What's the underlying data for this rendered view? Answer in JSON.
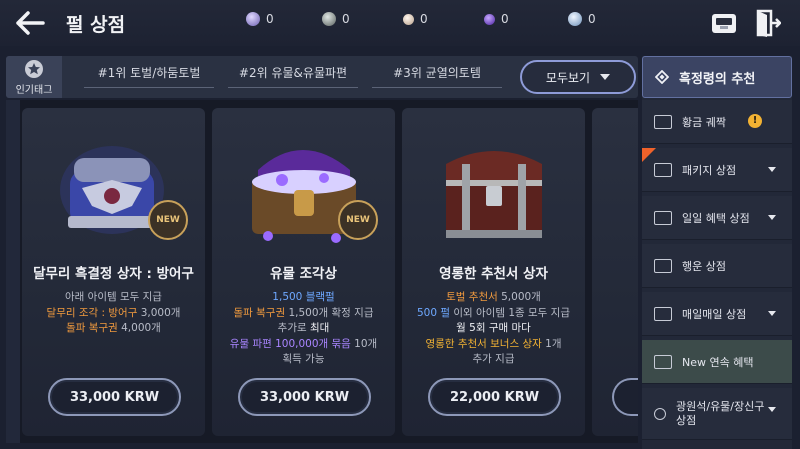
{
  "header": {
    "title": "펄 상점",
    "currencies": [
      {
        "icon": "moonstone-icon",
        "value": "0",
        "color": "#b7a9ff"
      },
      {
        "icon": "silver-coin-icon",
        "value": "0",
        "color": "#9aa3a0"
      },
      {
        "icon": "pearl-icon",
        "value": "0",
        "color": "#e8d8c8"
      },
      {
        "icon": "purple-pearl-icon",
        "value": "0",
        "color": "#7a4fd6"
      },
      {
        "icon": "blue-crystal-icon",
        "value": "0",
        "color": "#a8c8f0"
      }
    ]
  },
  "tagbar": {
    "popular_label": "인기태그",
    "tags": [
      "#1위 토벌/하둠토벌",
      "#2위 유물&유물파편",
      "#3위 균열의토템"
    ],
    "view_all": "모두보기"
  },
  "products": [
    {
      "name": "달무리 흑결정 상자 : 방어구",
      "badge": "NEW",
      "desc": [
        [
          {
            "t": "아래 아이템 모두 지급",
            "c": ""
          }
        ],
        [
          {
            "t": "달무리 조각 : 방어구",
            "c": "hl-orange"
          },
          {
            "t": " 3,000개",
            "c": ""
          }
        ],
        [
          {
            "t": "돌파 복구권",
            "c": "hl-orange"
          },
          {
            "t": " 4,000개",
            "c": ""
          }
        ]
      ],
      "price": "33,000 KRW"
    },
    {
      "name": "유물 조각상",
      "badge": "NEW",
      "desc": [
        [
          {
            "t": "1,500 블랙펄",
            "c": "hl-blue"
          }
        ],
        [
          {
            "t": "돌파 복구권",
            "c": "hl-orange"
          },
          {
            "t": " 1,500개 확정 지급",
            "c": ""
          }
        ],
        [
          {
            "t": "추가로 ",
            "c": ""
          },
          {
            "t": "최대",
            "c": "hl-white"
          }
        ],
        [
          {
            "t": "유물 파편 100,000개 묶음",
            "c": "hl-purple"
          },
          {
            "t": " 10개",
            "c": ""
          }
        ],
        [
          {
            "t": "획득 가능",
            "c": ""
          }
        ]
      ],
      "price": "33,000 KRW"
    },
    {
      "name": "영롱한 추천서 상자",
      "badge": "",
      "desc": [
        [
          {
            "t": "토벌 추천서",
            "c": "hl-orange"
          },
          {
            "t": " 5,000개",
            "c": ""
          }
        ],
        [
          {
            "t": "500 펄",
            "c": "hl-blue"
          },
          {
            "t": " 이외 아이템 1종 모두 지급",
            "c": ""
          }
        ],
        [
          {
            "t": "월 5회 구매 마다",
            "c": "hl-white"
          }
        ],
        [
          {
            "t": "영롱한 추천서 보너스 상자",
            "c": "hl-gold"
          },
          {
            "t": " 1개",
            "c": ""
          }
        ],
        [
          {
            "t": "추가 지급",
            "c": ""
          }
        ]
      ],
      "price": "22,000 KRW"
    }
  ],
  "sidebar": {
    "header": "흑정령의 추천",
    "items": [
      {
        "label": "황금 궤짝",
        "alert": "!",
        "arrow": false,
        "active": false,
        "sale": false
      },
      {
        "label": "패키지 상점",
        "alert": "",
        "arrow": true,
        "active": false,
        "sale": true
      },
      {
        "label": "일일 혜택 상점",
        "alert": "",
        "arrow": true,
        "active": false,
        "sale": false
      },
      {
        "label": "행운 상점",
        "alert": "",
        "arrow": false,
        "active": false,
        "sale": false
      },
      {
        "label": "매일매일 상점",
        "alert": "",
        "arrow": true,
        "active": false,
        "sale": false
      },
      {
        "label": "New 연속 혜택",
        "alert": "",
        "arrow": false,
        "active": true,
        "sale": false
      },
      {
        "label": "광원석/유물/장신구 상점",
        "alert": "",
        "arrow": true,
        "active": false,
        "sale": false
      }
    ]
  }
}
